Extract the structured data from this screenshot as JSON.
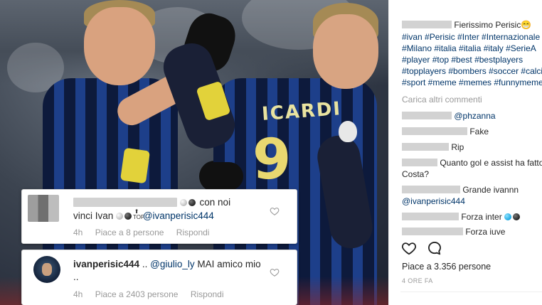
{
  "post": {
    "image_alt": "Two football players in striped jerseys high-fiving",
    "shirt_name": "ICARDI",
    "shirt_number": "9",
    "likes_text": "Piace a 3.356 persone",
    "time_text": "4 ORE FA"
  },
  "overlay_comments": [
    {
      "username": "",
      "text_after_name": "con noi",
      "line2_prefix": "vinci Ivan",
      "mention": "@ivanperisic444",
      "time": "4h",
      "likes": "Piace a 8 persone",
      "reply": "Rispondi"
    },
    {
      "username": "ivanperisic444",
      "prefix": "..",
      "mention": "@giulio_ly",
      "text": "MAI amico mio ..",
      "time": "4h",
      "likes": "Piace a 2403 persone",
      "reply": "Rispondi"
    }
  ],
  "sidebar": {
    "caption": "Fierissimo Perisic😁",
    "caption_username": "",
    "hashtag_lines": [
      "#ivan #Perisic #Inter #Internazionale",
      "#Milano #italia #italia #italy #SerieA",
      "#player #top #best #bestplayers",
      "#topplayers #bombers #soccer #calcio",
      "#sport #meme #memes #funnymemes"
    ],
    "load_more": "Carica altri commenti",
    "comments": [
      {
        "text": "@phzanna",
        "is_mention": true
      },
      {
        "text": "Fake"
      },
      {
        "text": "Rip"
      },
      {
        "text": "Quanto gol e assist ha fatto",
        "line2": "Costa?"
      },
      {
        "text": "Grande ivannn",
        "line2": "@ivanperisic444"
      },
      {
        "text": "Forza inter"
      },
      {
        "text": "Forza iuve"
      }
    ]
  },
  "icons": {
    "like": "heart-icon",
    "comment": "comment-bubble-icon",
    "small_like": "heart-outline-icon"
  },
  "colors": {
    "link": "#003569",
    "muted": "#999999",
    "text": "#262626",
    "jersey_blue": "#1d3f8a",
    "armband": "#e2d23a"
  }
}
